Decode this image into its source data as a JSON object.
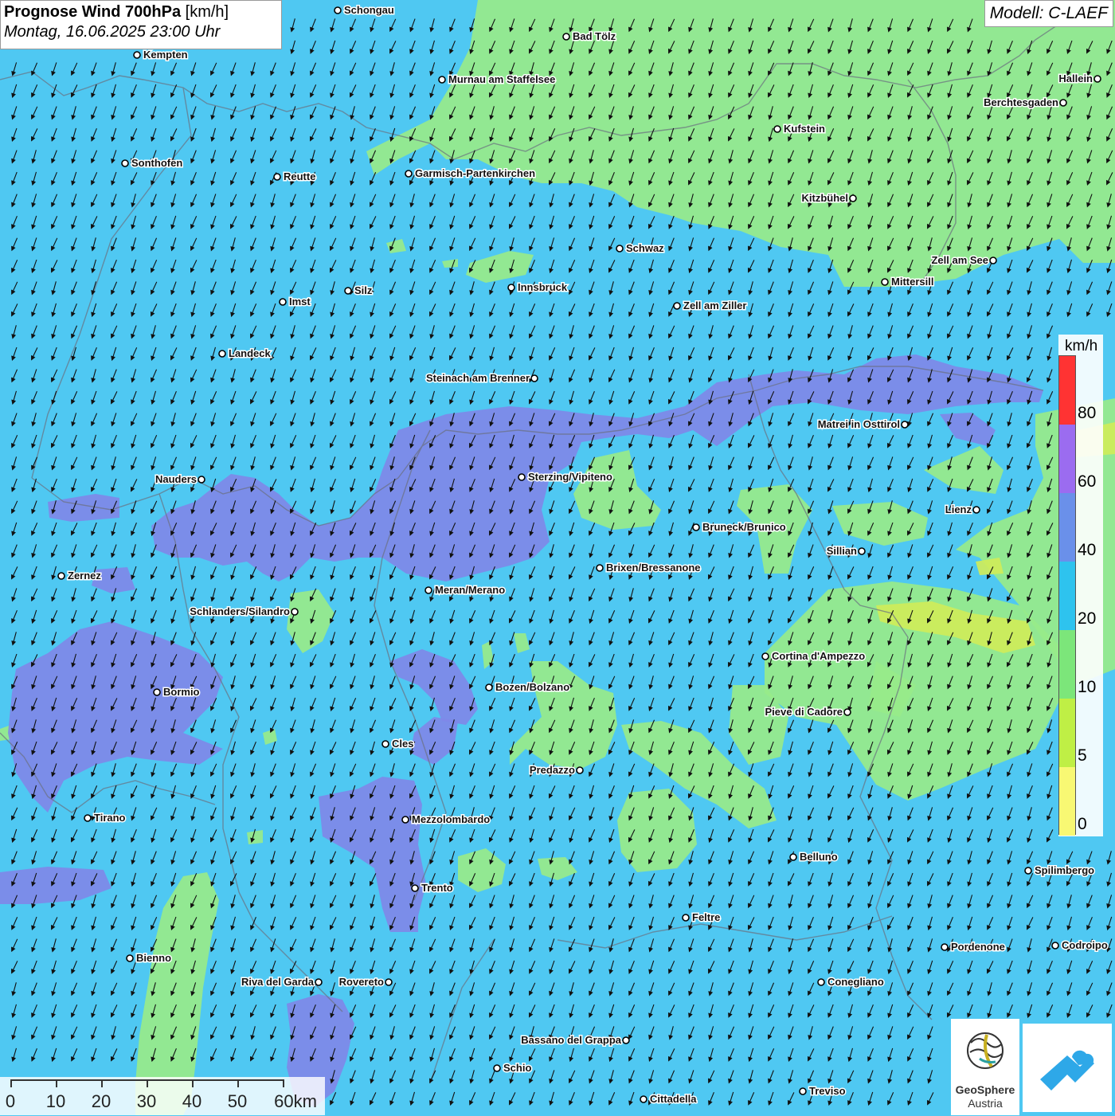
{
  "header": {
    "title_bold": "Prognose Wind 700hPa",
    "title_unit": "[km/h]",
    "datetime": "Montag, 16.06.2025 23:00 Uhr"
  },
  "model": {
    "label": "Modell: C-LAEF"
  },
  "legend": {
    "unit": "km/h",
    "bins": [
      {
        "label": "80",
        "color": "#ff3333"
      },
      {
        "label": "60",
        "color": "#9b6cf0"
      },
      {
        "label": "40",
        "color": "#6a90ea"
      },
      {
        "label": "20",
        "color": "#2ec3ee"
      },
      {
        "label": "10",
        "color": "#7ce67a"
      },
      {
        "label": "5",
        "color": "#bfef45"
      },
      {
        "label": "0",
        "color": "#f8f873"
      }
    ]
  },
  "scale": {
    "labels": [
      "0",
      "10",
      "20",
      "30",
      "40",
      "50",
      "60km"
    ]
  },
  "colors": {
    "ocean_blue": "#4fc8f2",
    "green": "#98ea8a",
    "purple": "#7f88e8",
    "yellow": "#cfeb5a"
  },
  "logos": {
    "geosphere_name": "GeoSphere",
    "geosphere_sub": "Austria"
  },
  "cities": [
    {
      "name": "Schongau",
      "align": "right"
    },
    {
      "name": "Bad Tölz",
      "align": "right"
    },
    {
      "name": "Kempten",
      "align": "right"
    },
    {
      "name": "Murnau am Staffelsee",
      "align": "right"
    },
    {
      "name": "Hallein",
      "align": "left"
    },
    {
      "name": "Berchtesgaden",
      "align": "left"
    },
    {
      "name": "Kufstein",
      "align": "right"
    },
    {
      "name": "Sonthofen",
      "align": "right"
    },
    {
      "name": "Reutte",
      "align": "right"
    },
    {
      "name": "Garmisch-Partenkirchen",
      "align": "right"
    },
    {
      "name": "Kitzbühel",
      "align": "left"
    },
    {
      "name": "Schwaz",
      "align": "right"
    },
    {
      "name": "Zell am See",
      "align": "left"
    },
    {
      "name": "Mittersill",
      "align": "right"
    },
    {
      "name": "Innsbruck",
      "align": "right"
    },
    {
      "name": "Silz",
      "align": "right"
    },
    {
      "name": "Imst",
      "align": "right"
    },
    {
      "name": "Zell am Ziller",
      "align": "right"
    },
    {
      "name": "Landeck",
      "align": "right"
    },
    {
      "name": "Steinach am Brenner",
      "align": "left"
    },
    {
      "name": "Matrei in Osttirol",
      "align": "left"
    },
    {
      "name": "Nauders",
      "align": "left"
    },
    {
      "name": "Sterzing/Vipiteno",
      "align": "right"
    },
    {
      "name": "Lienz",
      "align": "left"
    },
    {
      "name": "Bruneck/Brunico",
      "align": "right"
    },
    {
      "name": "Sillian",
      "align": "left"
    },
    {
      "name": "Brixen/Bressanone",
      "align": "right"
    },
    {
      "name": "Zernez",
      "align": "right"
    },
    {
      "name": "Meran/Merano",
      "align": "right"
    },
    {
      "name": "Schlanders/Silandro",
      "align": "left"
    },
    {
      "name": "Cortina d'Ampezzo",
      "align": "right"
    },
    {
      "name": "Bozen/Bolzano",
      "align": "right"
    },
    {
      "name": "Bormio",
      "align": "right"
    },
    {
      "name": "Pieve di Cadore",
      "align": "left"
    },
    {
      "name": "Cles",
      "align": "right"
    },
    {
      "name": "Predazzo",
      "align": "left"
    },
    {
      "name": "Tirano",
      "align": "right"
    },
    {
      "name": "Mezzolombardo",
      "align": "right"
    },
    {
      "name": "Belluno",
      "align": "right"
    },
    {
      "name": "Spilimbergo",
      "align": "right"
    },
    {
      "name": "Trento",
      "align": "right"
    },
    {
      "name": "Feltre",
      "align": "right"
    },
    {
      "name": "Pordenone",
      "align": "right"
    },
    {
      "name": "Codroipo",
      "align": "right"
    },
    {
      "name": "Bienno",
      "align": "right"
    },
    {
      "name": "Riva del Garda",
      "align": "left"
    },
    {
      "name": "Rovereto",
      "align": "left"
    },
    {
      "name": "Conegliano",
      "align": "right"
    },
    {
      "name": "Bassano del Grappa",
      "align": "left"
    },
    {
      "name": "Schio",
      "align": "right"
    },
    {
      "name": "Treviso",
      "align": "right"
    },
    {
      "name": "Cittadella",
      "align": "right"
    }
  ]
}
